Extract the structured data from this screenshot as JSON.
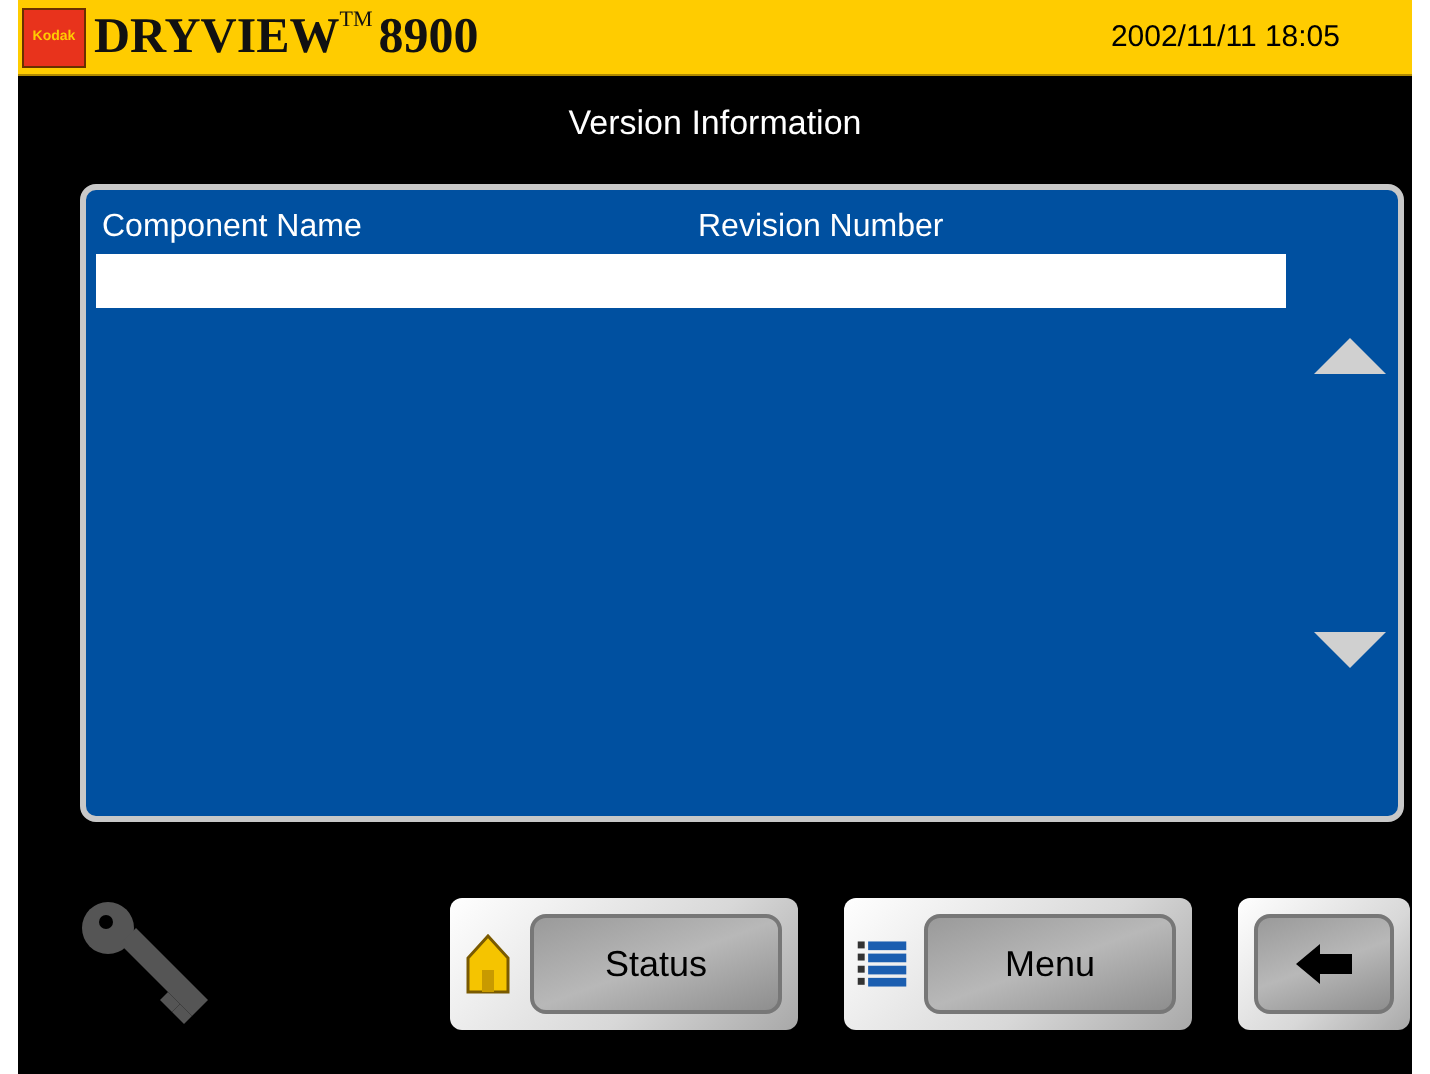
{
  "header": {
    "logo_text": "Kodak",
    "product": "DRYVIEW",
    "trademark": "TM",
    "model": "8900",
    "datetime": "2002/11/11 18:05"
  },
  "title": "Version Information",
  "table": {
    "columns": [
      "Component Name",
      "Revision Number"
    ],
    "rows": [
      {
        "selected": true
      }
    ]
  },
  "buttons": [
    {
      "kind": "home",
      "label": "Status"
    },
    {
      "kind": "menu",
      "label": "Menu"
    },
    {
      "kind": "back"
    }
  ]
}
